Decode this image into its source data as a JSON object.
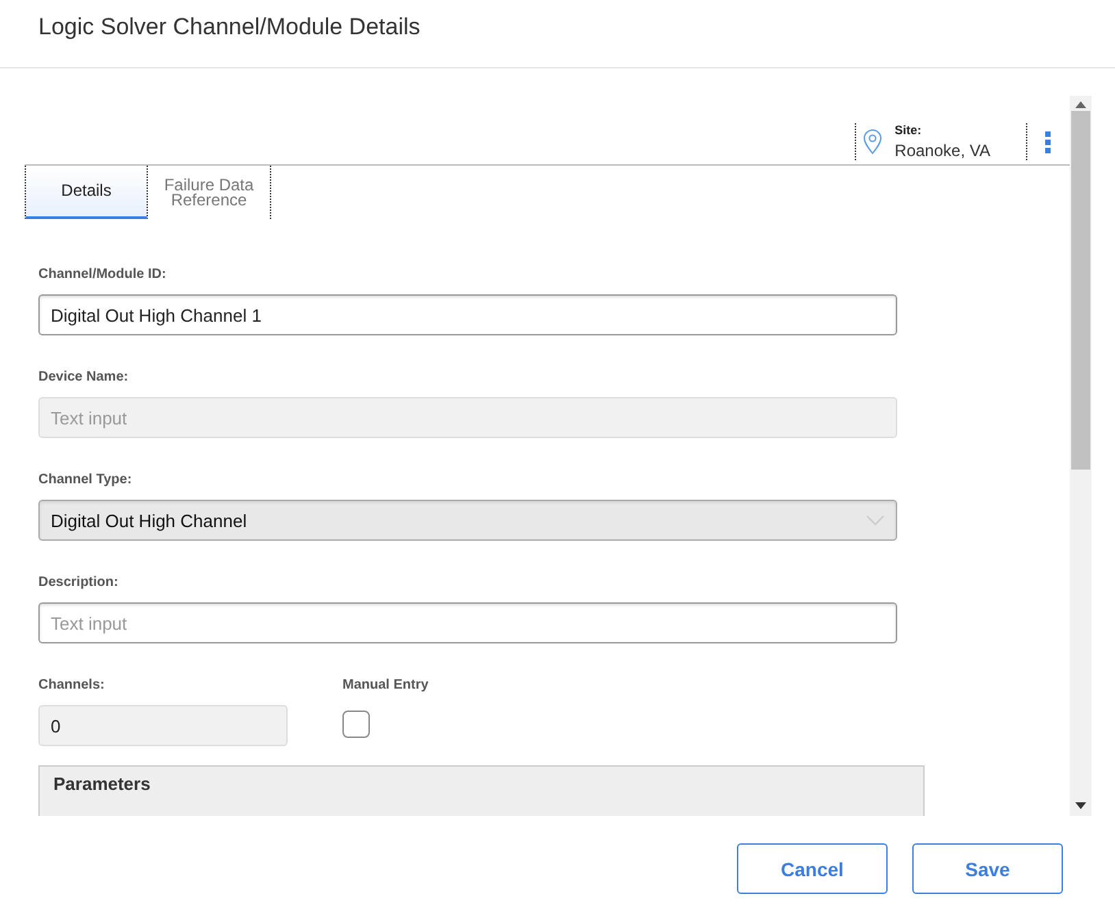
{
  "window": {
    "title": "Logic Solver Channel/Module Details"
  },
  "site": {
    "label": "Site:",
    "value": "Roanoke, VA"
  },
  "tabs": [
    {
      "label": "Details",
      "selected": true
    },
    {
      "label": "Failure Data Reference",
      "selected": false
    }
  ],
  "fields": [
    {
      "kind": "text",
      "label": "Channel/Module ID:",
      "value": "Digital Out High Channel 1",
      "disabled": false
    },
    {
      "kind": "text",
      "label": "Device Name:",
      "placeholder": "Text input",
      "disabled": true
    },
    {
      "kind": "select",
      "label": "Channel Type:",
      "value": "Digital Out High Channel",
      "disabled": true
    },
    {
      "kind": "text",
      "label": "Description:",
      "placeholder": "Text input",
      "disabled": false
    }
  ],
  "channels": {
    "label": "Channels:",
    "value": "0",
    "disabled": true
  },
  "manual_entry": {
    "label": "Manual Entry",
    "checked": false
  },
  "section": {
    "title": "Parameters"
  },
  "buttons": [
    "Cancel",
    "Save"
  ]
}
